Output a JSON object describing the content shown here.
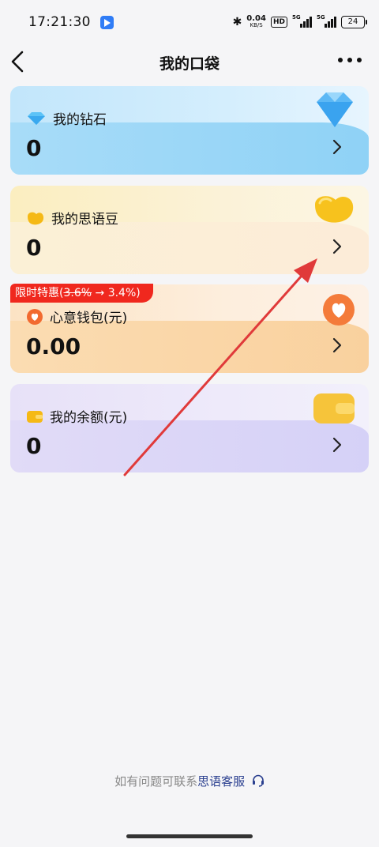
{
  "status_bar": {
    "time": "17:21:30",
    "speed_value": "0.04",
    "speed_unit": "KB/S",
    "hd_label": "HD",
    "signal1_label": "5G",
    "signal2_label": "5G",
    "battery": "24"
  },
  "header": {
    "title": "我的口袋"
  },
  "cards": [
    {
      "label": "我的钻石",
      "value": "0",
      "icon": "diamond-icon"
    },
    {
      "label": "我的思语豆",
      "value": "0",
      "icon": "bean-icon"
    },
    {
      "label": "心意钱包(元)",
      "value": "0.00",
      "icon": "heart-wallet-icon"
    },
    {
      "label": "我的余额(元)",
      "value": "0",
      "icon": "wallet-icon"
    }
  ],
  "promo": {
    "prefix": "限时特惠(",
    "old_rate": "3.6%",
    "arrow": " → ",
    "new_rate": "3.4%)"
  },
  "footer": {
    "text": "如有问题可联系",
    "link": "思语客服"
  },
  "colors": {
    "accent_link": "#2a3f8f",
    "promo_red": "#f0281e"
  }
}
